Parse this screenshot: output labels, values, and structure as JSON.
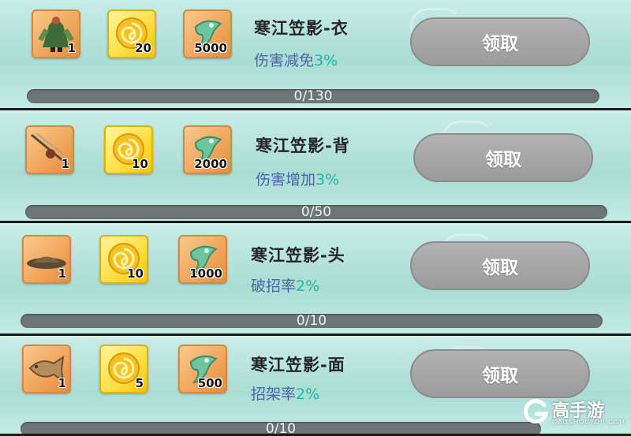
{
  "rows": [
    {
      "title": "寒江笠影-衣",
      "effect_label": "伤害减免",
      "effect_value": "3%",
      "rewards": [
        {
          "icon": "robe-costume-icon",
          "qty": "1"
        },
        {
          "icon": "gold-swirl-coin-icon",
          "qty": "20"
        },
        {
          "icon": "jade-pendant-icon",
          "qty": "5000"
        }
      ],
      "button": "领取",
      "progress_text": "0/130",
      "progress": 0
    },
    {
      "title": "寒江笠影-背",
      "effect_label": "伤害增加",
      "effect_value": "3%",
      "rewards": [
        {
          "icon": "fishing-rod-icon",
          "qty": "1"
        },
        {
          "icon": "gold-swirl-coin-icon",
          "qty": "10"
        },
        {
          "icon": "jade-pendant-icon",
          "qty": "2000"
        }
      ],
      "button": "领取",
      "progress_text": "0/50",
      "progress": 0
    },
    {
      "title": "寒江笠影-头",
      "effect_label": "破招率",
      "effect_value": "2%",
      "rewards": [
        {
          "icon": "bamboo-hat-icon",
          "qty": "1"
        },
        {
          "icon": "gold-swirl-coin-icon",
          "qty": "10"
        },
        {
          "icon": "jade-pendant-icon",
          "qty": "1000"
        }
      ],
      "button": "领取",
      "progress_text": "0/10",
      "progress": 0
    },
    {
      "title": "寒江笠影-面",
      "effect_label": "招架率",
      "effect_value": "2%",
      "rewards": [
        {
          "icon": "fish-mask-icon",
          "qty": "1"
        },
        {
          "icon": "gold-swirl-coin-icon",
          "qty": "5"
        },
        {
          "icon": "jade-pendant-icon",
          "qty": "500"
        }
      ],
      "button": "领取",
      "progress_text": "0/10",
      "progress": 0
    }
  ],
  "watermark": {
    "text": "高手游",
    "sub": "GAOSHOUYOU.COM"
  },
  "colors": {
    "effect_label": "#4d64a8",
    "effect_value": "#1fb7a2",
    "button": "#a8a8a8",
    "bar": "#6f7575"
  }
}
